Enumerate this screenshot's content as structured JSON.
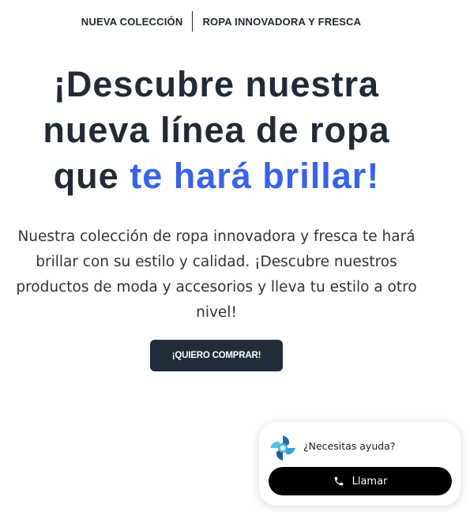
{
  "topbar": {
    "left_label": "NUEVA COLECCIÓN",
    "right_label": "ROPA INNOVADORA Y FRESCA"
  },
  "hero": {
    "headline_line1": "¡Descubre nuestra",
    "headline_line2": "nueva línea de ropa",
    "headline_line3_start": "que ",
    "headline_highlight": "te hará brillar!",
    "highlight_color": "#3863e6",
    "description": "Nuestra colección de ropa innovadora y fresca te hará brillar con su estilo y calidad. ¡Descubre nuestros productos de moda y accesorios y lleva tu estilo a otro nivel!",
    "cta_label": "¡QUIERO COMPRAR!"
  },
  "help_widget": {
    "logo_icon": "assistant-logo-icon",
    "question": "¿Necesitas ayuda?",
    "call_icon": "phone-icon",
    "call_label": "Llamar"
  },
  "colors": {
    "text_dark": "#222b35",
    "accent_blue": "#3863e6",
    "cta_background": "#212b3a",
    "call_button_background": "#000000"
  }
}
